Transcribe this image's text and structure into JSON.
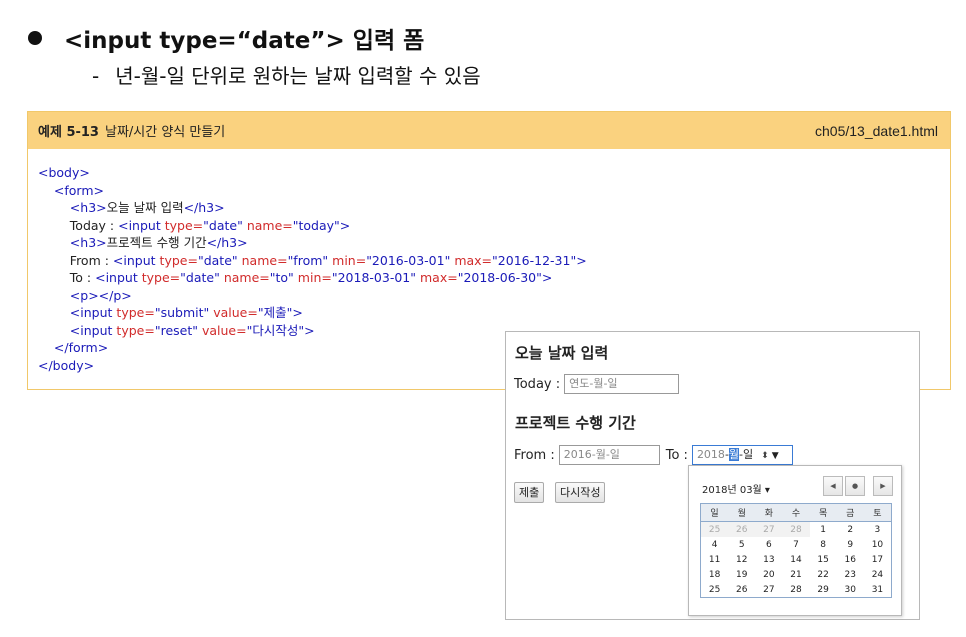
{
  "slide": {
    "heading": "<input type=“date”> 입력 폼",
    "subline_dash": "-",
    "subline": "년-월-일 단위로 원하는 날짜 입력할 수 있음"
  },
  "example": {
    "number": "예제 5-13",
    "title": "날짜/시간 양식 만들기",
    "path": "ch05/13_date1.html"
  },
  "browser": {
    "title_today": "오늘 날짜 입력",
    "today_label": "Today :",
    "today_placeholder": "연도-월-일",
    "title_project": "프로젝트 수행 기간",
    "from_label": "From :",
    "from_placeholder": "2016-월-일",
    "to_label": "To :",
    "to_year": "2018",
    "to_month": "월",
    "to_day": "일",
    "submit": "제출",
    "reset": "다시작성"
  },
  "picker": {
    "month_label": "2018년 03월 ▾",
    "weekdays": [
      "일",
      "월",
      "화",
      "수",
      "목",
      "금",
      "토"
    ],
    "weeks": [
      [
        "25",
        "26",
        "27",
        "28",
        "1",
        "2",
        "3"
      ],
      [
        "4",
        "5",
        "6",
        "7",
        "8",
        "9",
        "10"
      ],
      [
        "11",
        "12",
        "13",
        "14",
        "15",
        "16",
        "17"
      ],
      [
        "18",
        "19",
        "20",
        "21",
        "22",
        "23",
        "24"
      ],
      [
        "25",
        "26",
        "27",
        "28",
        "29",
        "30",
        "31"
      ]
    ],
    "prev_month_cells": 4
  }
}
